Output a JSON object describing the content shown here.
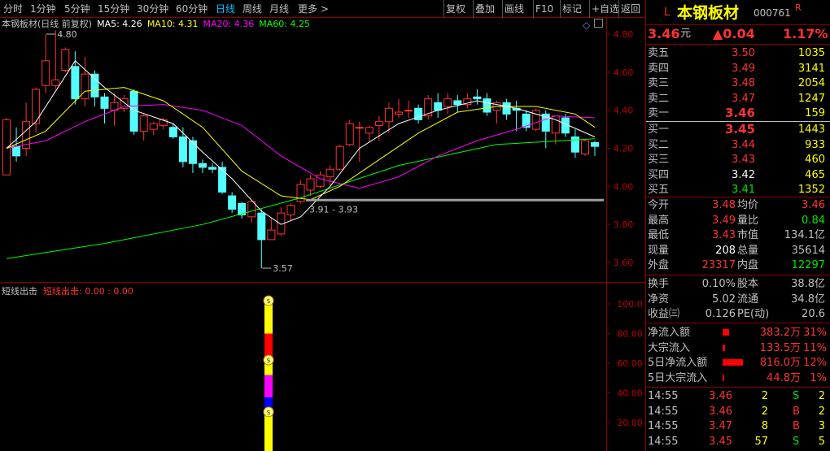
{
  "toolbar": {
    "timeframes": [
      "分时",
      "1分钟",
      "5分钟",
      "15分钟",
      "30分钟",
      "60分钟",
      "日线",
      "周线",
      "月线",
      "更多 >"
    ],
    "active_timeframe": "日线",
    "buttons": [
      "复权",
      "叠加",
      "画线",
      "F10",
      "标记",
      "+自选",
      "返回"
    ]
  },
  "chart": {
    "legend_title": "本钢板材(日线 前复权)",
    "ma5": "MA5: 4.26",
    "ma10": "MA10: 4.31",
    "ma20": "MA20: 4.36",
    "ma60": "MA60: 4.25",
    "high_marker": "4.80",
    "low_marker": "3.57",
    "range_marker": "3.91 - 3.93",
    "colors": {
      "up": "#ff3232",
      "down": "#54ffff",
      "ma5": "#ffffff",
      "ma10": "#ffff00",
      "ma20": "#ff00ff",
      "ma60": "#00ff00"
    }
  },
  "indicator": {
    "name": "短线出击",
    "values": "短线出击: 0.00 : 0.00"
  },
  "chart_data": [
    {
      "type": "candlestick",
      "title": "本钢板材(日线 前复权)",
      "ylim": [
        3.55,
        4.85
      ],
      "yticks": [
        "4.80",
        "4.60",
        "4.40",
        "4.20",
        "4.00",
        "3.80",
        "3.60"
      ],
      "candles": [
        {
          "o": 4.06,
          "h": 4.36,
          "l": 4.06,
          "c": 4.35
        },
        {
          "o": 4.21,
          "h": 4.31,
          "l": 4.13,
          "c": 4.16
        },
        {
          "o": 4.2,
          "h": 4.44,
          "l": 4.16,
          "c": 4.34
        },
        {
          "o": 4.33,
          "h": 4.52,
          "l": 4.28,
          "c": 4.51
        },
        {
          "o": 4.53,
          "h": 4.8,
          "l": 4.49,
          "c": 4.66
        },
        {
          "o": 4.53,
          "h": 4.82,
          "l": 4.51,
          "c": 4.56
        },
        {
          "o": 4.61,
          "h": 4.73,
          "l": 4.6,
          "c": 4.72
        },
        {
          "o": 4.63,
          "h": 4.71,
          "l": 4.43,
          "c": 4.46
        },
        {
          "o": 4.46,
          "h": 4.68,
          "l": 4.42,
          "c": 4.59
        },
        {
          "o": 4.59,
          "h": 4.61,
          "l": 4.42,
          "c": 4.47
        },
        {
          "o": 4.47,
          "h": 4.49,
          "l": 4.33,
          "c": 4.41
        },
        {
          "o": 4.4,
          "h": 4.49,
          "l": 4.32,
          "c": 4.44
        },
        {
          "o": 4.41,
          "h": 4.48,
          "l": 4.39,
          "c": 4.46
        },
        {
          "o": 4.5,
          "h": 4.51,
          "l": 4.27,
          "c": 4.29
        },
        {
          "o": 4.29,
          "h": 4.38,
          "l": 4.24,
          "c": 4.37
        },
        {
          "o": 4.3,
          "h": 4.34,
          "l": 4.27,
          "c": 4.33
        },
        {
          "o": 4.32,
          "h": 4.36,
          "l": 4.3,
          "c": 4.35
        },
        {
          "o": 4.31,
          "h": 4.33,
          "l": 4.25,
          "c": 4.26
        },
        {
          "o": 4.26,
          "h": 4.31,
          "l": 4.1,
          "c": 4.13
        },
        {
          "o": 4.24,
          "h": 4.26,
          "l": 4.07,
          "c": 4.12
        },
        {
          "o": 4.12,
          "h": 4.14,
          "l": 4.07,
          "c": 4.1
        },
        {
          "o": 4.1,
          "h": 4.12,
          "l": 4.07,
          "c": 4.09
        },
        {
          "o": 4.1,
          "h": 4.13,
          "l": 3.96,
          "c": 3.97
        },
        {
          "o": 3.95,
          "h": 3.97,
          "l": 3.86,
          "c": 3.88
        },
        {
          "o": 3.91,
          "h": 3.92,
          "l": 3.83,
          "c": 3.85
        },
        {
          "o": 3.84,
          "h": 3.93,
          "l": 3.81,
          "c": 3.92
        },
        {
          "o": 3.86,
          "h": 3.88,
          "l": 3.57,
          "c": 3.72
        },
        {
          "o": 3.72,
          "h": 3.83,
          "l": 3.72,
          "c": 3.77
        },
        {
          "o": 3.75,
          "h": 3.89,
          "l": 3.74,
          "c": 3.86
        },
        {
          "o": 3.85,
          "h": 3.91,
          "l": 3.82,
          "c": 3.9
        },
        {
          "o": 3.92,
          "h": 4.03,
          "l": 3.91,
          "c": 4.01
        },
        {
          "o": 3.98,
          "h": 4.06,
          "l": 3.95,
          "c": 4.04
        },
        {
          "o": 4.0,
          "h": 4.08,
          "l": 3.99,
          "c": 4.06
        },
        {
          "o": 4.05,
          "h": 4.11,
          "l": 4.0,
          "c": 4.09
        },
        {
          "o": 4.09,
          "h": 4.22,
          "l": 4.08,
          "c": 4.21
        },
        {
          "o": 4.22,
          "h": 4.35,
          "l": 4.21,
          "c": 4.33
        },
        {
          "o": 4.31,
          "h": 4.34,
          "l": 4.13,
          "c": 4.31
        },
        {
          "o": 4.28,
          "h": 4.32,
          "l": 4.23,
          "c": 4.31
        },
        {
          "o": 4.32,
          "h": 4.37,
          "l": 4.24,
          "c": 4.34
        },
        {
          "o": 4.34,
          "h": 4.44,
          "l": 4.28,
          "c": 4.41
        },
        {
          "o": 4.38,
          "h": 4.46,
          "l": 4.36,
          "c": 4.39
        },
        {
          "o": 4.4,
          "h": 4.45,
          "l": 4.36,
          "c": 4.4
        },
        {
          "o": 4.41,
          "h": 4.43,
          "l": 4.33,
          "c": 4.35
        },
        {
          "o": 4.37,
          "h": 4.48,
          "l": 4.35,
          "c": 4.46
        },
        {
          "o": 4.44,
          "h": 4.49,
          "l": 4.36,
          "c": 4.4
        },
        {
          "o": 4.42,
          "h": 4.49,
          "l": 4.38,
          "c": 4.46
        },
        {
          "o": 4.45,
          "h": 4.48,
          "l": 4.39,
          "c": 4.43
        },
        {
          "o": 4.43,
          "h": 4.49,
          "l": 4.41,
          "c": 4.46
        },
        {
          "o": 4.47,
          "h": 4.51,
          "l": 4.43,
          "c": 4.46
        },
        {
          "o": 4.46,
          "h": 4.49,
          "l": 4.37,
          "c": 4.39
        },
        {
          "o": 4.4,
          "h": 4.45,
          "l": 4.33,
          "c": 4.44
        },
        {
          "o": 4.44,
          "h": 4.46,
          "l": 4.35,
          "c": 4.38
        },
        {
          "o": 4.41,
          "h": 4.45,
          "l": 4.29,
          "c": 4.4
        },
        {
          "o": 4.38,
          "h": 4.4,
          "l": 4.29,
          "c": 4.31
        },
        {
          "o": 4.3,
          "h": 4.41,
          "l": 4.29,
          "c": 4.4
        },
        {
          "o": 4.38,
          "h": 4.4,
          "l": 4.2,
          "c": 4.29
        },
        {
          "o": 4.28,
          "h": 4.37,
          "l": 4.22,
          "c": 4.37
        },
        {
          "o": 4.36,
          "h": 4.38,
          "l": 4.26,
          "c": 4.28
        },
        {
          "o": 4.26,
          "h": 4.3,
          "l": 4.15,
          "c": 4.18
        },
        {
          "o": 4.17,
          "h": 4.25,
          "l": 4.16,
          "c": 4.24
        },
        {
          "o": 4.23,
          "h": 4.24,
          "l": 4.16,
          "c": 4.21
        }
      ],
      "ma5": [
        [
          0,
          4.2
        ],
        [
          3,
          4.34
        ],
        [
          7,
          4.66
        ],
        [
          10,
          4.52
        ],
        [
          13,
          4.4
        ],
        [
          17,
          4.33
        ],
        [
          20,
          4.18
        ],
        [
          23,
          4.04
        ],
        [
          26,
          3.87
        ],
        [
          28,
          3.8
        ],
        [
          30,
          3.84
        ],
        [
          33,
          4.0
        ],
        [
          36,
          4.2
        ],
        [
          40,
          4.33
        ],
        [
          44,
          4.4
        ],
        [
          48,
          4.45
        ],
        [
          52,
          4.41
        ],
        [
          56,
          4.35
        ],
        [
          60,
          4.26
        ]
      ],
      "ma10": [
        [
          0,
          4.2
        ],
        [
          4,
          4.29
        ],
        [
          8,
          4.5
        ],
        [
          12,
          4.52
        ],
        [
          16,
          4.45
        ],
        [
          20,
          4.31
        ],
        [
          24,
          4.08
        ],
        [
          28,
          3.95
        ],
        [
          31,
          3.93
        ],
        [
          34,
          4.0
        ],
        [
          38,
          4.14
        ],
        [
          42,
          4.28
        ],
        [
          46,
          4.39
        ],
        [
          50,
          4.42
        ],
        [
          54,
          4.42
        ],
        [
          58,
          4.38
        ],
        [
          60,
          4.31
        ]
      ],
      "ma20": [
        [
          0,
          4.2
        ],
        [
          4,
          4.24
        ],
        [
          8,
          4.34
        ],
        [
          12,
          4.42
        ],
        [
          16,
          4.43
        ],
        [
          20,
          4.4
        ],
        [
          24,
          4.32
        ],
        [
          28,
          4.16
        ],
        [
          32,
          4.04
        ],
        [
          36,
          3.99
        ],
        [
          40,
          4.05
        ],
        [
          44,
          4.16
        ],
        [
          48,
          4.24
        ],
        [
          52,
          4.3
        ],
        [
          56,
          4.37
        ],
        [
          60,
          4.36
        ]
      ],
      "ma60": [
        [
          0,
          3.62
        ],
        [
          10,
          3.7
        ],
        [
          20,
          3.8
        ],
        [
          30,
          3.94
        ],
        [
          40,
          4.11
        ],
        [
          50,
          4.22
        ],
        [
          60,
          4.25
        ]
      ]
    },
    {
      "type": "bar",
      "title": "短线出击",
      "ylim": [
        0,
        110
      ],
      "yticks": [
        "100.0",
        "80.00",
        "60.00",
        "40.00",
        "20.00"
      ],
      "segments": [
        {
          "from": 100,
          "to": 80,
          "color": "#ffff00"
        },
        {
          "from": 80,
          "to": 63,
          "color": "#ff0000"
        },
        {
          "from": 63,
          "to": 52,
          "color": "#ffff00"
        },
        {
          "from": 52,
          "to": 37,
          "color": "#ff00ff"
        },
        {
          "from": 37,
          "to": 27,
          "color": "#0000ff"
        },
        {
          "from": 27,
          "to": 0,
          "color": "#ffff00"
        }
      ],
      "coin_levels": [
        100,
        60,
        25
      ]
    }
  ],
  "quote": {
    "marker": "L",
    "name": "本钢板材",
    "code": "000761",
    "badge": "R",
    "price": "3.46",
    "price_unit": "元",
    "change": "▲0.04",
    "change_pct": "1.17%",
    "asks": [
      {
        "label": "卖五",
        "price": "3.50",
        "vol": "1035"
      },
      {
        "label": "卖四",
        "price": "3.49",
        "vol": "3141"
      },
      {
        "label": "卖三",
        "price": "3.48",
        "vol": "2054"
      },
      {
        "label": "卖二",
        "price": "3.47",
        "vol": "1247"
      },
      {
        "label": "卖一",
        "price": "3.46",
        "vol": "159"
      }
    ],
    "bids": [
      {
        "label": "买一",
        "price": "3.45",
        "vol": "1443"
      },
      {
        "label": "买二",
        "price": "3.44",
        "vol": "933"
      },
      {
        "label": "买三",
        "price": "3.43",
        "vol": "460"
      },
      {
        "label": "买四",
        "price": "3.42",
        "vol": "465"
      },
      {
        "label": "买五",
        "price": "3.41",
        "vol": "1352"
      }
    ],
    "stats": [
      {
        "l1": "今开",
        "v1": "3.48",
        "c1": "red",
        "l2": "均价",
        "v2": "3.46",
        "c2": "red"
      },
      {
        "l1": "最高",
        "v1": "3.49",
        "c1": "red",
        "l2": "量比",
        "v2": "0.84",
        "c2": "grn"
      },
      {
        "l1": "最低",
        "v1": "3.43",
        "c1": "red",
        "l2": "市值",
        "v2": "134.1亿",
        "c2": "gry"
      },
      {
        "l1": "现量",
        "v1": "208",
        "c1": "wht",
        "l2": "总量",
        "v2": "35614",
        "c2": "gry"
      },
      {
        "l1": "外盘",
        "v1": "23317",
        "c1": "red",
        "l2": "内盘",
        "v2": "12297",
        "c2": "grn"
      }
    ],
    "fund": [
      {
        "l1": "换手",
        "v1": "0.10%",
        "l2": "股本",
        "v2": "38.8亿"
      },
      {
        "l1": "净资",
        "v1": "5.02",
        "l2": "流通",
        "v2": "34.8亿"
      },
      {
        "l1": "收益㈢",
        "v1": "0.126",
        "l2": "PE(动)",
        "v2": "20.6"
      }
    ],
    "flows": [
      {
        "label": "净流入额",
        "amount": "383.2万",
        "pct": "31%",
        "bar": 0.31
      },
      {
        "label": "大宗流入",
        "amount": "133.5万",
        "pct": "11%",
        "bar": 0.11
      },
      {
        "label": "5日净流入额",
        "amount": "816.0万",
        "pct": "12%",
        "bar": 0.95
      },
      {
        "label": "5日大宗流入",
        "amount": "44.8万",
        "pct": "1%",
        "bar": 0.01
      }
    ],
    "ticks": [
      {
        "time": "14:55",
        "price": "3.46",
        "pc": "red",
        "vol": "2",
        "side": "S",
        "sc": "grn",
        "n": "2"
      },
      {
        "time": "14:55",
        "price": "3.46",
        "pc": "red",
        "vol": "2",
        "side": "B",
        "sc": "red",
        "n": "2"
      },
      {
        "time": "14:55",
        "price": "3.47",
        "pc": "red",
        "vol": "8",
        "side": "B",
        "sc": "red",
        "n": "3"
      },
      {
        "time": "14:55",
        "price": "3.45",
        "pc": "red",
        "vol": "57",
        "side": "S",
        "sc": "grn",
        "n": "5"
      }
    ]
  }
}
